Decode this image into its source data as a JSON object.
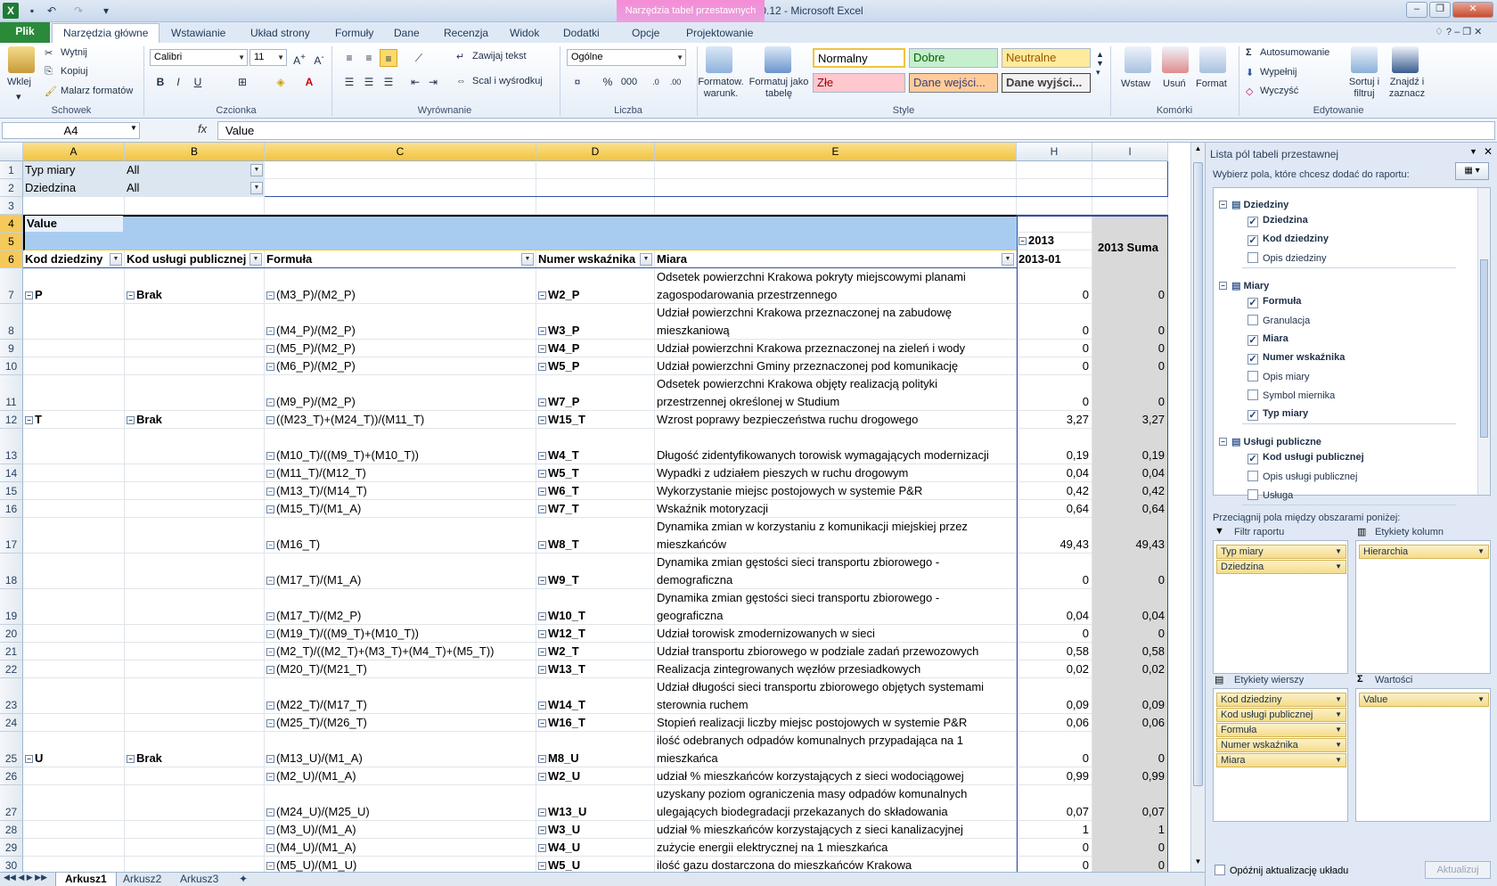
{
  "window": {
    "title": "OLAP_wsk dziedzinowe_10.12 - Microsoft Excel",
    "context_tab_group": "Narzędzia tabel przestawnych"
  },
  "tabs": [
    "Plik",
    "Narzędzia główne",
    "Wstawianie",
    "Układ strony",
    "Formuły",
    "Dane",
    "Recenzja",
    "Widok",
    "Dodatki",
    "Opcje",
    "Projektowanie"
  ],
  "ribbon": {
    "clipboard": {
      "paste": "Wklej",
      "cut": "Wytnij",
      "copy": "Kopiuj",
      "painter": "Malarz formatów",
      "label": "Schowek"
    },
    "font": {
      "name": "Calibri",
      "size": "11",
      "label": "Czcionka"
    },
    "alignment": {
      "wrap": "Zawijaj tekst",
      "merge": "Scal i wyśrodkuj",
      "label": "Wyrównanie"
    },
    "number": {
      "format": "Ogólne",
      "percent": "%",
      "thousands": "000",
      "label": "Liczba"
    },
    "styles": {
      "conditional": "Formatow. warunk.",
      "table": "Formatuj jako tabelę",
      "normal": "Normalny",
      "good": "Dobre",
      "neutral": "Neutralne",
      "bad": "Złe",
      "input": "Dane wejści...",
      "output": "Dane wyjści...",
      "label": "Style"
    },
    "cells": {
      "insert": "Wstaw",
      "delete": "Usuń",
      "format": "Format",
      "label": "Komórki"
    },
    "editing": {
      "autosum": "Autosumowanie",
      "fill": "Wypełnij",
      "clear": "Wyczyść",
      "sort": "Sortuj i filtruj",
      "find": "Znajdź i zaznacz",
      "label": "Edytowanie"
    }
  },
  "formula_bar": {
    "name_box": "A4",
    "fx": "fx",
    "value": "Value"
  },
  "columns": [
    "A",
    "B",
    "C",
    "D",
    "E",
    "H",
    "I"
  ],
  "filters": [
    {
      "label": "Typ miary",
      "value": "All"
    },
    {
      "label": "Dziedzina",
      "value": "All"
    }
  ],
  "pivot": {
    "value_label": "Value",
    "year": "2013",
    "year_total": "2013 Suma",
    "month": "2013-01",
    "headers": [
      "Kod dziedziny",
      "Kod usługi publicznej",
      "Formuła",
      "Numer wskaźnika",
      "Miara"
    ]
  },
  "rows": [
    {
      "n": "7",
      "a": "P",
      "b": "Brak",
      "c": "(M3_P)/(M2_P)",
      "d": "W2_P",
      "e1": "Odsetek powierzchni Krakowa pokryty miejscowymi planami",
      "e2": "zagospodarowania przestrzennego",
      "h": "0",
      "i": "0"
    },
    {
      "n": "8",
      "a": "",
      "b": "",
      "c": "(M4_P)/(M2_P)",
      "d": "W3_P",
      "e1": "Udział powierzchni Krakowa przeznaczonej na zabudowę",
      "e2": "mieszkaniową",
      "h": "0",
      "i": "0"
    },
    {
      "n": "9",
      "a": "",
      "b": "",
      "c": "(M5_P)/(M2_P)",
      "d": "W4_P",
      "e1": "",
      "e2": "Udział powierzchni Krakowa przeznaczonej na zieleń i wody",
      "h": "0",
      "i": "0"
    },
    {
      "n": "10",
      "a": "",
      "b": "",
      "c": "(M6_P)/(M2_P)",
      "d": "W5_P",
      "e1": "",
      "e2": "Udział powierzchni Gminy przeznaczonej pod komunikację",
      "h": "0",
      "i": "0"
    },
    {
      "n": "11",
      "a": "",
      "b": "",
      "c": "(M9_P)/(M2_P)",
      "d": "W7_P",
      "e1": "Odsetek powierzchni Krakowa objęty realizacją polityki",
      "e2": "przestrzennej określonej w Studium",
      "h": "0",
      "i": "0"
    },
    {
      "n": "12",
      "a": "T",
      "b": "Brak",
      "c": "((M23_T)+(M24_T))/(M11_T)",
      "d": "W15_T",
      "e1": "",
      "e2": "Wzrost poprawy bezpieczeństwa ruchu drogowego",
      "h": "3,27",
      "i": "3,27"
    },
    {
      "n": "13",
      "a": "",
      "b": "",
      "c": "(M10_T)/((M9_T)+(M10_T))",
      "d": "W4_T",
      "e1": "",
      "e2": "Długość zidentyfikowanych torowisk wymagających modernizacji",
      "h": "0,19",
      "i": "0,19"
    },
    {
      "n": "14",
      "a": "",
      "b": "",
      "c": "(M11_T)/(M12_T)",
      "d": "W5_T",
      "e1": "",
      "e2": "Wypadki z udziałem pieszych w ruchu drogowym",
      "h": "0,04",
      "i": "0,04"
    },
    {
      "n": "15",
      "a": "",
      "b": "",
      "c": "(M13_T)/(M14_T)",
      "d": "W6_T",
      "e1": "",
      "e2": "Wykorzystanie miejsc postojowych w systemie P&R",
      "h": "0,42",
      "i": "0,42"
    },
    {
      "n": "16",
      "a": "",
      "b": "",
      "c": "(M15_T)/(M1_A)",
      "d": "W7_T",
      "e1": "",
      "e2": "Wskaźnik motoryzacji",
      "h": "0,64",
      "i": "0,64"
    },
    {
      "n": "17",
      "a": "",
      "b": "",
      "c": "(M16_T)",
      "d": "W8_T",
      "e1": "Dynamika zmian w korzystaniu z komunikacji miejskiej przez",
      "e2": "mieszkańców",
      "h": "49,43",
      "i": "49,43"
    },
    {
      "n": "18",
      "a": "",
      "b": "",
      "c": "(M17_T)/(M1_A)",
      "d": "W9_T",
      "e1": "Dynamika zmian gęstości sieci transportu zbiorowego -",
      "e2": "demograficzna",
      "h": "0",
      "i": "0"
    },
    {
      "n": "19",
      "a": "",
      "b": "",
      "c": "(M17_T)/(M2_P)",
      "d": "W10_T",
      "e1": "Dynamika zmian gęstości sieci transportu zbiorowego -",
      "e2": "geograficzna",
      "h": "0,04",
      "i": "0,04"
    },
    {
      "n": "20",
      "a": "",
      "b": "",
      "c": "(M19_T)/((M9_T)+(M10_T))",
      "d": "W12_T",
      "e1": "",
      "e2": "Udział torowisk zmodernizowanych w sieci",
      "h": "0",
      "i": "0"
    },
    {
      "n": "21",
      "a": "",
      "b": "",
      "c": "(M2_T)/((M2_T)+(M3_T)+(M4_T)+(M5_T))",
      "d": "W2_T",
      "e1": "",
      "e2": "Udział transportu zbiorowego w podziale zadań przewozowych",
      "h": "0,58",
      "i": "0,58"
    },
    {
      "n": "22",
      "a": "",
      "b": "",
      "c": "(M20_T)/(M21_T)",
      "d": "W13_T",
      "e1": "",
      "e2": "Realizacja zintegrowanych węzłów przesiadkowych",
      "h": "0,02",
      "i": "0,02"
    },
    {
      "n": "23",
      "a": "",
      "b": "",
      "c": "(M22_T)/(M17_T)",
      "d": "W14_T",
      "e1": "Udział długości sieci transportu zbiorowego objętych systemami",
      "e2": "sterownia ruchem",
      "h": "0,09",
      "i": "0,09"
    },
    {
      "n": "24",
      "a": "",
      "b": "",
      "c": "(M25_T)/(M26_T)",
      "d": "W16_T",
      "e1": "",
      "e2": "Stopień realizacji liczby miejsc postojowych w systemie P&R",
      "h": "0,06",
      "i": "0,06"
    },
    {
      "n": "25",
      "a": "U",
      "b": "Brak",
      "c": "(M13_U)/(M1_A)",
      "d": "M8_U",
      "e1": "ilość odebranych odpadów komunalnych przypadająca na 1",
      "e2": "mieszkańca",
      "h": "0",
      "i": "0"
    },
    {
      "n": "26",
      "a": "",
      "b": "",
      "c": "(M2_U)/(M1_A)",
      "d": "W2_U",
      "e1": "",
      "e2": "udział % mieszkańców korzystających z sieci wodociągowej",
      "h": "0,99",
      "i": "0,99"
    },
    {
      "n": "27",
      "a": "",
      "b": "",
      "c": "(M24_U)/(M25_U)",
      "d": "W13_U",
      "e1": "uzyskany poziom ograniczenia masy odpadów komunalnych",
      "e2": "ulegających biodegradacji przekazanych do składowania",
      "h": "0,07",
      "i": "0,07"
    },
    {
      "n": "28",
      "a": "",
      "b": "",
      "c": "(M3_U)/(M1_A)",
      "d": "W3_U",
      "e1": "",
      "e2": "udział % mieszkańców korzystających z sieci kanalizacyjnej",
      "h": "1",
      "i": "1"
    },
    {
      "n": "29",
      "a": "",
      "b": "",
      "c": "(M4_U)/(M1_A)",
      "d": "W4_U",
      "e1": "",
      "e2": "zużycie energii elektrycznej na 1 mieszkańca",
      "h": "0",
      "i": "0"
    },
    {
      "n": "30",
      "a": "",
      "b": "",
      "c": "(M5_U)/(M1_U)",
      "d": "W5_U",
      "e1": "",
      "e2": "ilość gazu dostarczona do mieszkańców Krakowa",
      "h": "0",
      "i": "0"
    }
  ],
  "sheets": [
    "Arkusz1",
    "Arkusz2",
    "Arkusz3"
  ],
  "field_list": {
    "title": "Lista pól tabeli przestawnej",
    "prompt": "Wybierz pola, które chcesz dodać do raportu:",
    "groups": [
      {
        "name": "Dziedziny",
        "fields": [
          {
            "name": "Dziedzina",
            "checked": true
          },
          {
            "name": "Kod dziedziny",
            "checked": true
          },
          {
            "name": "Opis dziedziny",
            "checked": false
          }
        ]
      },
      {
        "name": "Miary",
        "fields": [
          {
            "name": "Formuła",
            "checked": true
          },
          {
            "name": "Granulacja",
            "checked": false
          },
          {
            "name": "Miara",
            "checked": true
          },
          {
            "name": "Numer wskaźnika",
            "checked": true
          },
          {
            "name": "Opis miary",
            "checked": false
          },
          {
            "name": "Symbol miernika",
            "checked": false
          },
          {
            "name": "Typ miary",
            "checked": true
          }
        ]
      },
      {
        "name": "Usługi publiczne",
        "fields": [
          {
            "name": "Kod usługi publicznej",
            "checked": true
          },
          {
            "name": "Opis usługi publicznej",
            "checked": false
          },
          {
            "name": "Usługa",
            "checked": false
          }
        ]
      }
    ],
    "drag_prompt": "Przeciągnij pola między obszarami poniżej:",
    "report_filter": "Filtr raportu",
    "column_labels": "Etykiety kolumn",
    "row_labels": "Etykiety wierszy",
    "values": "Wartości",
    "filter_items": [
      "Typ miary",
      "Dziedzina"
    ],
    "column_items": [
      "Hierarchia"
    ],
    "row_items": [
      "Kod dziedziny",
      "Kod usługi publicznej",
      "Formuła",
      "Numer wskaźnika",
      "Miara"
    ],
    "value_items": [
      "Value"
    ],
    "defer": "Opóźnij aktualizację układu",
    "update": "Aktualizuj"
  }
}
